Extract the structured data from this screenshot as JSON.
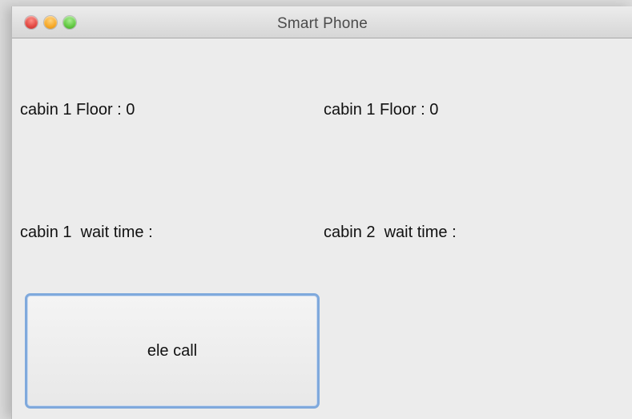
{
  "window": {
    "title": "Smart Phone"
  },
  "labels": {
    "cabin_1_floor_left": "cabin 1 Floor : 0",
    "cabin_1_floor_right": "cabin 1 Floor : 0",
    "cabin_1_wait_time": "cabin 1  wait time :",
    "cabin_2_wait_time": "cabin 2  wait time :"
  },
  "buttons": {
    "ele_call": "ele call"
  },
  "icons": {
    "close": "close-window-icon",
    "minimize": "minimize-window-icon",
    "zoom": "zoom-window-icon"
  },
  "colors": {
    "close": "#e0443e",
    "minimize": "#f6a623",
    "zoom": "#5ec63d",
    "focus_ring": "#7fa9dc"
  }
}
